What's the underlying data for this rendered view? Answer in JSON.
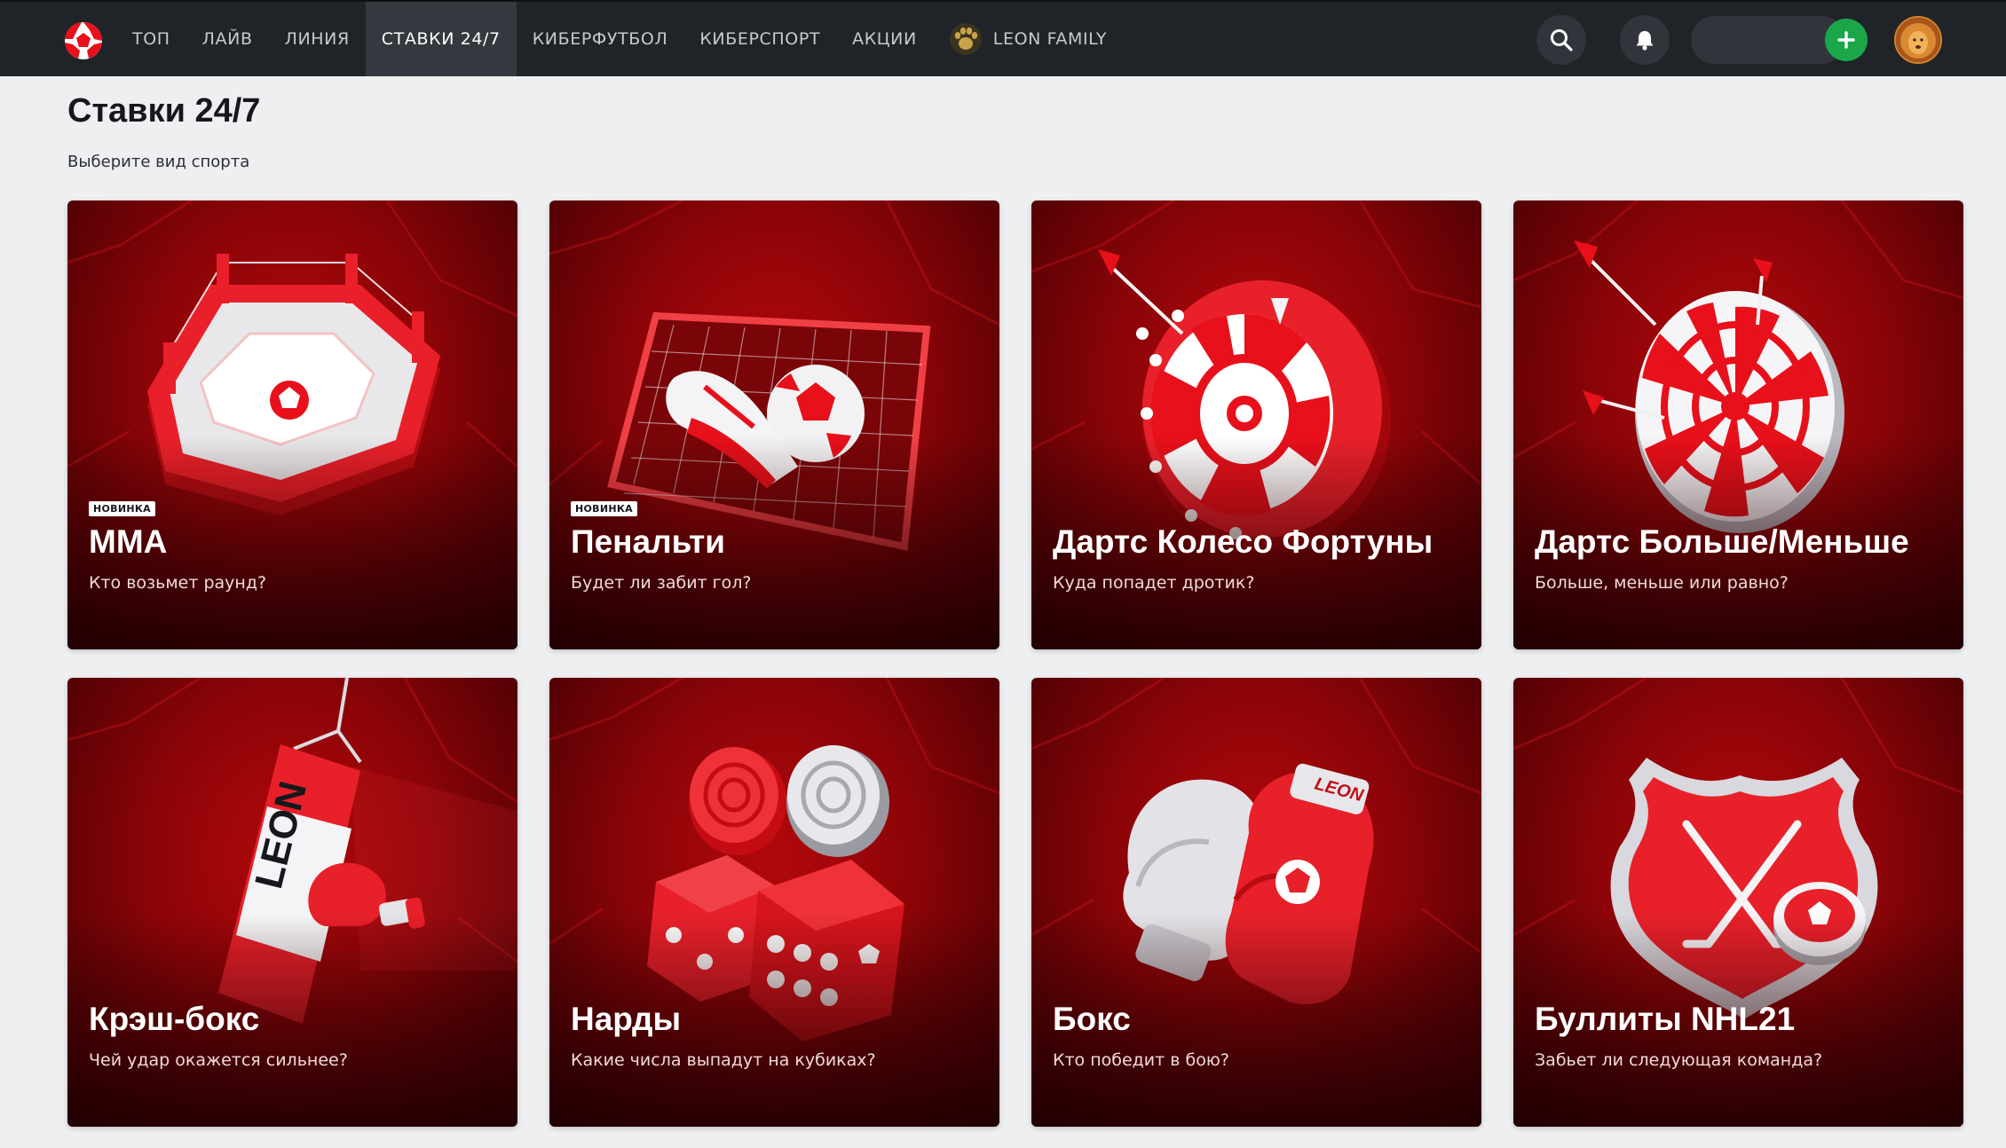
{
  "header": {
    "nav": [
      {
        "label": "ТОП",
        "active": false
      },
      {
        "label": "ЛАЙВ",
        "active": false
      },
      {
        "label": "ЛИНИЯ",
        "active": false
      },
      {
        "label": "СТАВКИ 24/7",
        "active": true
      },
      {
        "label": "КИБЕРФУТБОЛ",
        "active": false
      },
      {
        "label": "КИБЕРСПОРТ",
        "active": false
      },
      {
        "label": "АКЦИИ",
        "active": false
      },
      {
        "label": "LEON FAMILY",
        "active": false,
        "icon": "paw-icon"
      }
    ],
    "icons": [
      "logo-icon",
      "search-icon",
      "bell-icon",
      "plus-icon",
      "avatar"
    ],
    "colors": {
      "bar": "#202328",
      "deposit": "#19a74a",
      "accent": "#e8101a"
    }
  },
  "page": {
    "title": "Ставки 24/7",
    "subtitle": "Выберите вид спорта"
  },
  "cards": [
    {
      "title": "MMA",
      "subtitle": "Кто возьмет раунд?",
      "badge": "НОВИНКА",
      "icon": "octagon-ring-icon"
    },
    {
      "title": "Пенальти",
      "subtitle": "Будет ли забит гол?",
      "badge": "НОВИНКА",
      "icon": "goal-ball-boot-icon"
    },
    {
      "title": "Дартс Колесо Фортуны",
      "subtitle": "Куда попадет дротик?",
      "badge": "",
      "icon": "dart-wheel-icon"
    },
    {
      "title": "Дартс Больше/Меньше",
      "subtitle": "Больше, меньше или равно?",
      "badge": "",
      "icon": "dartboard-icon"
    },
    {
      "title": "Крэш-бокс",
      "subtitle": "Чей удар окажется сильнее?",
      "badge": "",
      "icon": "punching-bag-icon"
    },
    {
      "title": "Нарды",
      "subtitle": "Какие числа выпадут на кубиках?",
      "badge": "",
      "icon": "dice-checkers-icon"
    },
    {
      "title": "Бокс",
      "subtitle": "Кто победит в бою?",
      "badge": "",
      "icon": "boxing-gloves-icon"
    },
    {
      "title": "Буллиты NHL21",
      "subtitle": "Забьет ли следующая команда?",
      "badge": "",
      "icon": "hockey-shield-icon"
    }
  ],
  "card_art_labels": {
    "bag_brand": "LEON",
    "glove_brand": "LEON"
  }
}
